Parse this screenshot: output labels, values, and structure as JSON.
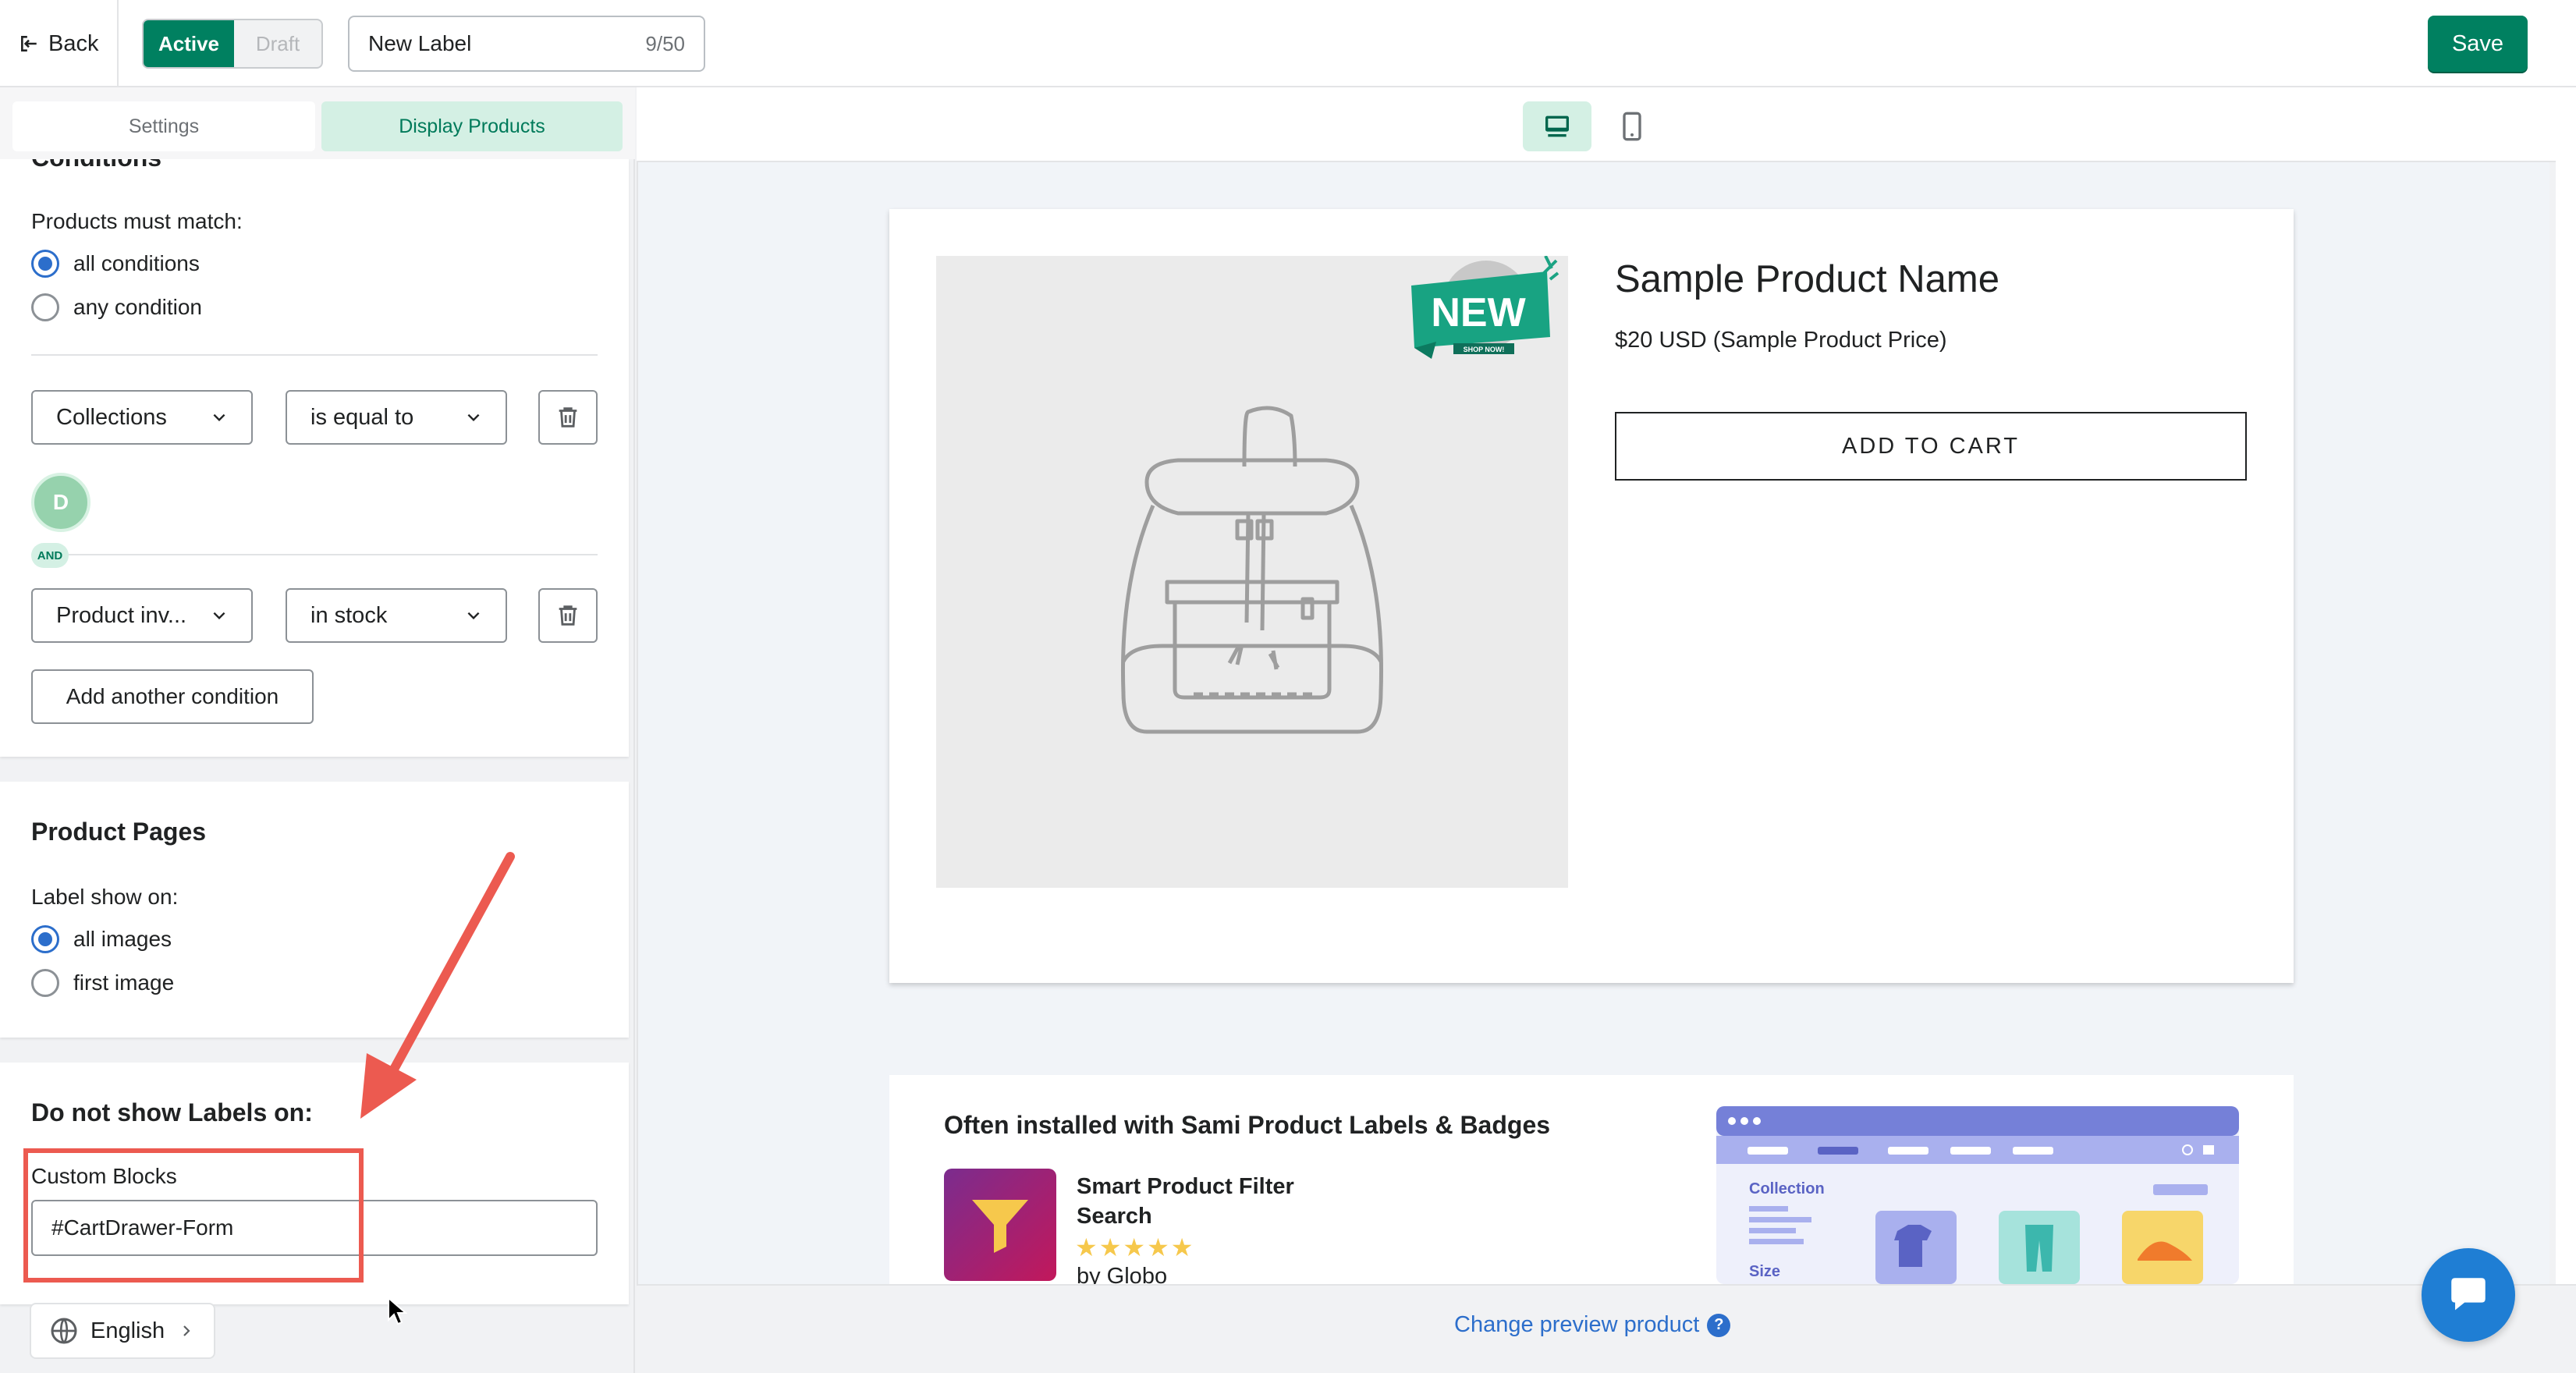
{
  "header": {
    "back_label": "Back",
    "status_active": "Active",
    "status_draft": "Draft",
    "label_name": "New Label",
    "label_count": "9/50",
    "save_label": "Save"
  },
  "tabs": [
    {
      "label": "Settings",
      "active": false
    },
    {
      "label": "Display Products",
      "active": true
    }
  ],
  "conditions": {
    "heading": "Conditions",
    "match_label": "Products must match:",
    "options": [
      {
        "label": "all conditions",
        "selected": true
      },
      {
        "label": "any condition",
        "selected": false
      }
    ],
    "rows": [
      {
        "field": "Collections",
        "operator": "is equal to"
      },
      {
        "field": "Product inv...",
        "operator": "in stock"
      }
    ],
    "collection_avatar": "D",
    "and_badge": "AND",
    "add_label": "Add another condition"
  },
  "product_pages": {
    "heading": "Product Pages",
    "show_on_label": "Label show on:",
    "options": [
      {
        "label": "all images",
        "selected": true
      },
      {
        "label": "first image",
        "selected": false
      }
    ]
  },
  "exclusions": {
    "heading": "Do not show Labels on:",
    "custom_blocks_label": "Custom Blocks",
    "custom_blocks_value": "#CartDrawer-Form"
  },
  "language": {
    "label": "English"
  },
  "preview": {
    "product_name": "Sample Product Name",
    "product_price": "$20 USD (Sample Product Price)",
    "add_to_cart": "ADD TO CART",
    "badge_text": "NEW",
    "badge_subtext": "SHOP NOW!"
  },
  "promo": {
    "title": "Often installed with Sami Product Labels & Badges",
    "app_name": "Smart Product Filter Search",
    "stars": "★★★★★",
    "by": "by Globo",
    "shot_collection": "Collection",
    "shot_size": "Size"
  },
  "footer": {
    "change_preview": "Change preview product",
    "help": "?"
  },
  "colors": {
    "primary": "#008060",
    "accent_blue": "#2c6ecb",
    "annotation_red": "#ec5a50"
  }
}
